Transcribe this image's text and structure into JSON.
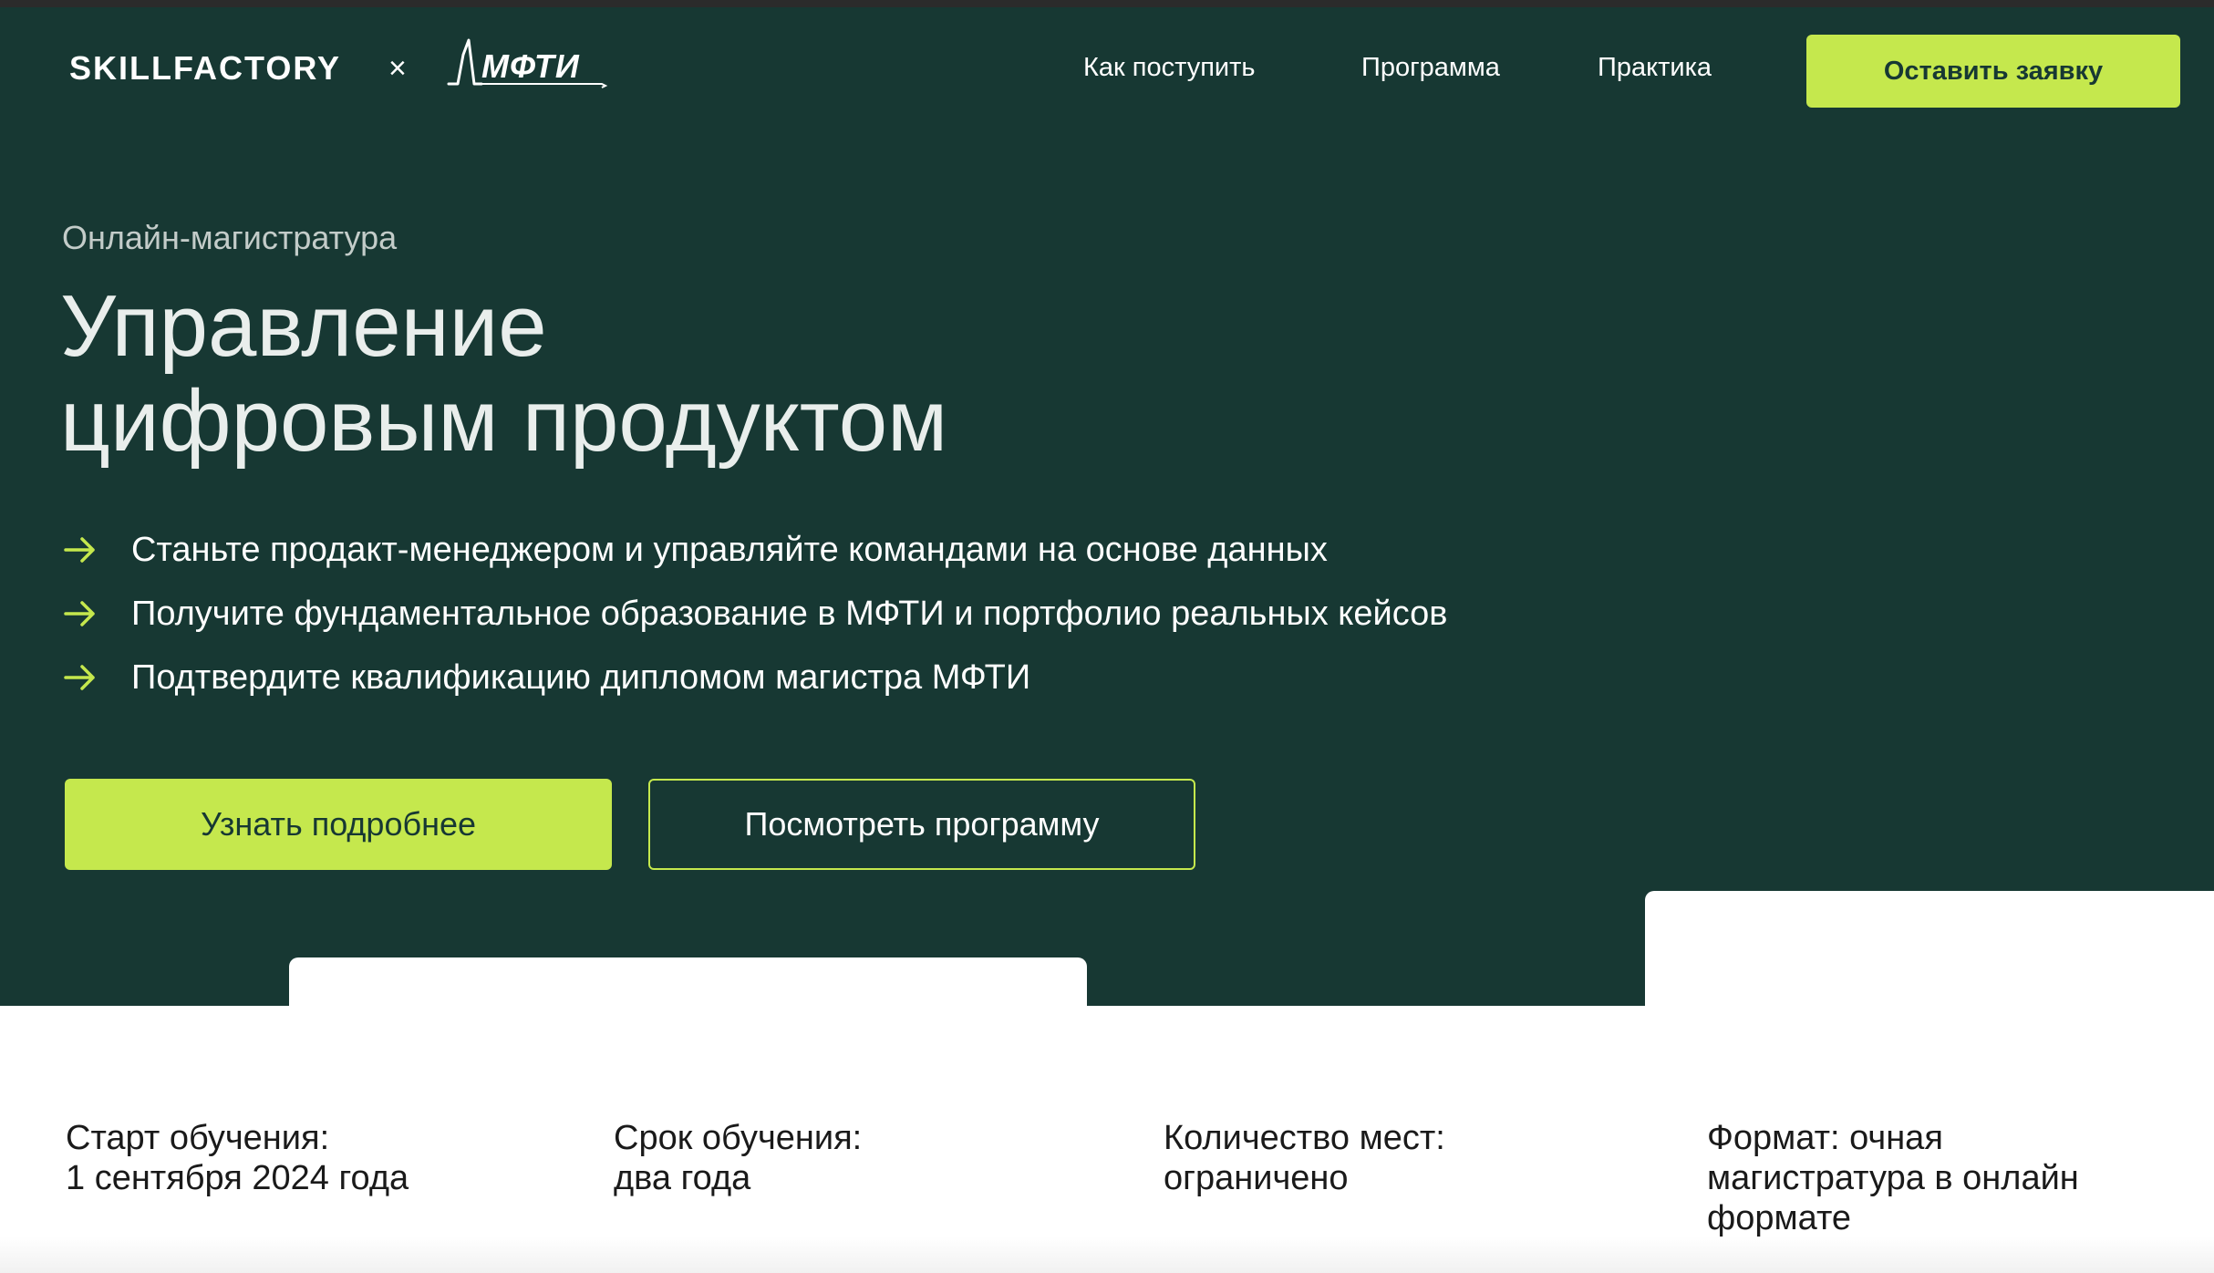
{
  "header": {
    "logo": "SKILLFACTORY",
    "separator": "×",
    "partner_logo": "МФТИ",
    "nav": [
      {
        "label": "Как поступить"
      },
      {
        "label": "Программа"
      },
      {
        "label": "Практика"
      }
    ],
    "cta_label": "Оставить заявку"
  },
  "hero": {
    "eyebrow": "Онлайн-магистратура",
    "title_line1": "Управление",
    "title_line2": "цифровым продуктом",
    "bullets": [
      {
        "text": "Станьте продакт-менеджером и управляйте командами на основе данных",
        "icon": "arrow-right-icon"
      },
      {
        "text": "Получите фундаментальное образование в МФТИ и портфолио реальных кейсов",
        "icon": "arrow-right-icon"
      },
      {
        "text": "Подтвердите квалификацию дипломом магистра МФТИ",
        "icon": "arrow-right-icon"
      }
    ],
    "primary_button": "Узнать подробнее",
    "secondary_button": "Посмотреть программу"
  },
  "facts": [
    {
      "lines": [
        "Старт обучения:",
        "1 сентября 2024 года"
      ]
    },
    {
      "lines": [
        "Срок обучения:",
        "два года"
      ]
    },
    {
      "lines": [
        "Количество мест:",
        "ограничено"
      ]
    },
    {
      "lines": [
        "Формат: очная",
        "магистратура в онлайн",
        "формате"
      ]
    }
  ],
  "colors": {
    "background_dark": "#173833",
    "accent": "#c5e84d",
    "text_light": "#ffffff",
    "text_muted": "#c3ccc9"
  }
}
